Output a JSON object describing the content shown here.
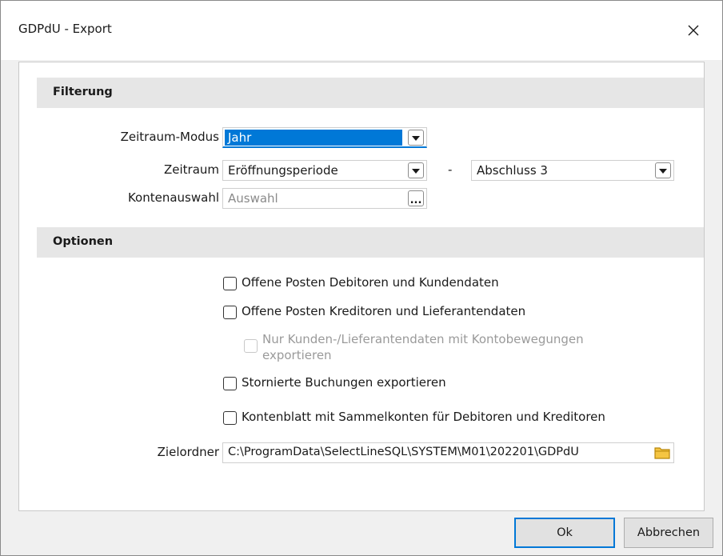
{
  "window": {
    "title": "GDPdU - Export",
    "close_label": "×"
  },
  "filter": {
    "header": "Filterung",
    "mode_label": "Zeitraum-Modus",
    "mode_value": "Jahr",
    "period_label": "Zeitraum",
    "period_from": "Eröffnungsperiode",
    "separator": "-",
    "period_to": "Abschluss 3",
    "accounts_label": "Kontenauswahl",
    "accounts_placeholder": "Auswahl",
    "ellipsis": "..."
  },
  "options": {
    "header": "Optionen",
    "debtors": "Offene Posten Debitoren und Kundendaten",
    "creditors": "Offene Posten Kreditoren und Lieferantendaten",
    "only_moved_line1": "Nur Kunden-/Lieferantendaten mit Kontobewegungen",
    "only_moved_line2": "exportieren",
    "cancelled": "Stornierte Buchungen exportieren",
    "sheet": "Kontenblatt mit Sammelkonten für Debitoren und Kreditoren",
    "target_label": "Zielordner",
    "target_value": "C:\\ProgramData\\SelectLineSQL\\SYSTEM\\M01\\202201\\GDPdU"
  },
  "buttons": {
    "ok": "Ok",
    "cancel": "Abbrechen"
  },
  "colors": {
    "accent": "#0078d7",
    "section_bg": "#e6e6e6",
    "folder": "#f5c542"
  }
}
